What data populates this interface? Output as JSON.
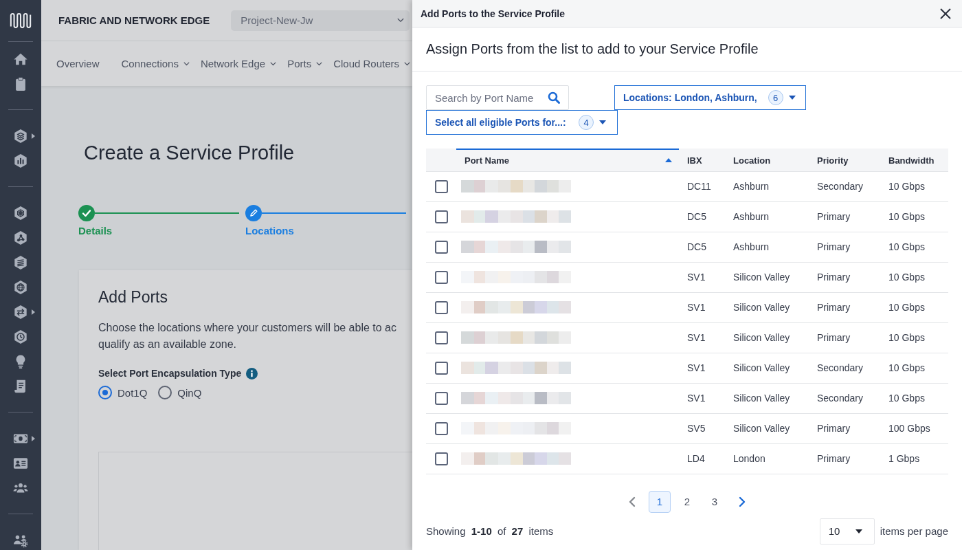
{
  "sidebar": {
    "groups": [
      {
        "items": [
          {
            "submenu": false
          },
          {
            "submenu": false
          }
        ]
      },
      {
        "items": [
          {
            "submenu": true
          },
          {
            "submenu": false
          }
        ]
      },
      {
        "items": [
          {
            "submenu": false
          },
          {
            "submenu": false
          },
          {
            "submenu": false
          },
          {
            "submenu": false
          },
          {
            "submenu": true
          },
          {
            "submenu": false
          },
          {
            "submenu": false
          },
          {
            "submenu": false
          }
        ]
      },
      {
        "items": [
          {
            "submenu": true
          },
          {
            "submenu": false
          },
          {
            "submenu": false
          }
        ]
      },
      {
        "items": [
          {
            "submenu": false
          }
        ]
      }
    ]
  },
  "header": {
    "title": "FABRIC AND NETWORK EDGE",
    "project": "Project-New-Jw"
  },
  "nav": [
    {
      "label": "Overview",
      "dropdown": false
    },
    {
      "label": "Connections",
      "dropdown": true
    },
    {
      "label": "Network Edge",
      "dropdown": true
    },
    {
      "label": "Ports",
      "dropdown": true
    },
    {
      "label": "Cloud Routers",
      "dropdown": true
    }
  ],
  "page": {
    "title": "Create a Service Profile",
    "steps": [
      {
        "label": "Details",
        "completed": true,
        "current": false
      },
      {
        "label": "Locations",
        "completed": false,
        "current": true
      }
    ],
    "card": {
      "title": "Add Ports",
      "description": [
        "Choose the locations where your customers will be able to ac",
        "qualify as an available zone."
      ],
      "encapsulation": {
        "label": "Select Port Encapsulation Type",
        "options": [
          {
            "label": "Dot1Q",
            "selected": true
          },
          {
            "label": "QinQ",
            "selected": false
          }
        ]
      }
    }
  },
  "panel": {
    "title": "Add Ports to the Service Profile",
    "subtitle": "Assign Ports from the list to add to your Service Profile",
    "search": {
      "placeholder": "Search by Port Name"
    },
    "filters": [
      {
        "label": "Locations: London, Ashburn,",
        "count": "6"
      },
      {
        "label": "Select all eligible Ports for...:",
        "count": "4"
      }
    ],
    "table": {
      "columns": [
        {
          "label": "Port Name",
          "sorted": true
        },
        {
          "label": "IBX",
          "sorted": false
        },
        {
          "label": "Location",
          "sorted": false
        },
        {
          "label": "Priority",
          "sorted": false
        },
        {
          "label": "Bandwidth",
          "sorted": false
        }
      ],
      "rows": [
        {
          "checked": false,
          "name_redacted": true,
          "ibx": "DC11",
          "location": "Ashburn",
          "priority": "Secondary",
          "bandwidth": "10 Gbps"
        },
        {
          "checked": false,
          "name_redacted": true,
          "ibx": "DC5",
          "location": "Ashburn",
          "priority": "Primary",
          "bandwidth": "10 Gbps"
        },
        {
          "checked": false,
          "name_redacted": true,
          "ibx": "DC5",
          "location": "Ashburn",
          "priority": "Primary",
          "bandwidth": "10 Gbps"
        },
        {
          "checked": false,
          "name_redacted": true,
          "ibx": "SV1",
          "location": "Silicon Valley",
          "priority": "Primary",
          "bandwidth": "10 Gbps"
        },
        {
          "checked": false,
          "name_redacted": true,
          "ibx": "SV1",
          "location": "Silicon Valley",
          "priority": "Primary",
          "bandwidth": "10 Gbps"
        },
        {
          "checked": false,
          "name_redacted": true,
          "ibx": "SV1",
          "location": "Silicon Valley",
          "priority": "Primary",
          "bandwidth": "10 Gbps"
        },
        {
          "checked": false,
          "name_redacted": true,
          "ibx": "SV1",
          "location": "Silicon Valley",
          "priority": "Secondary",
          "bandwidth": "10 Gbps"
        },
        {
          "checked": false,
          "name_redacted": true,
          "ibx": "SV1",
          "location": "Silicon Valley",
          "priority": "Secondary",
          "bandwidth": "10 Gbps"
        },
        {
          "checked": false,
          "name_redacted": true,
          "ibx": "SV5",
          "location": "Silicon Valley",
          "priority": "Primary",
          "bandwidth": "100 Gbps"
        },
        {
          "checked": false,
          "name_redacted": true,
          "ibx": "LD4",
          "location": "London",
          "priority": "Primary",
          "bandwidth": "1 Gbps"
        }
      ]
    },
    "pagination": {
      "previous": {
        "disabled": true
      },
      "pages": [
        {
          "label": "1",
          "selected": true
        },
        {
          "label": "2",
          "selected": false
        },
        {
          "label": "3",
          "selected": false
        }
      ],
      "next": {
        "disabled": false
      }
    },
    "footer": {
      "summary": "Showing **1-10** of **27** items",
      "per_page": "10",
      "per_page_label": "items per page"
    }
  }
}
